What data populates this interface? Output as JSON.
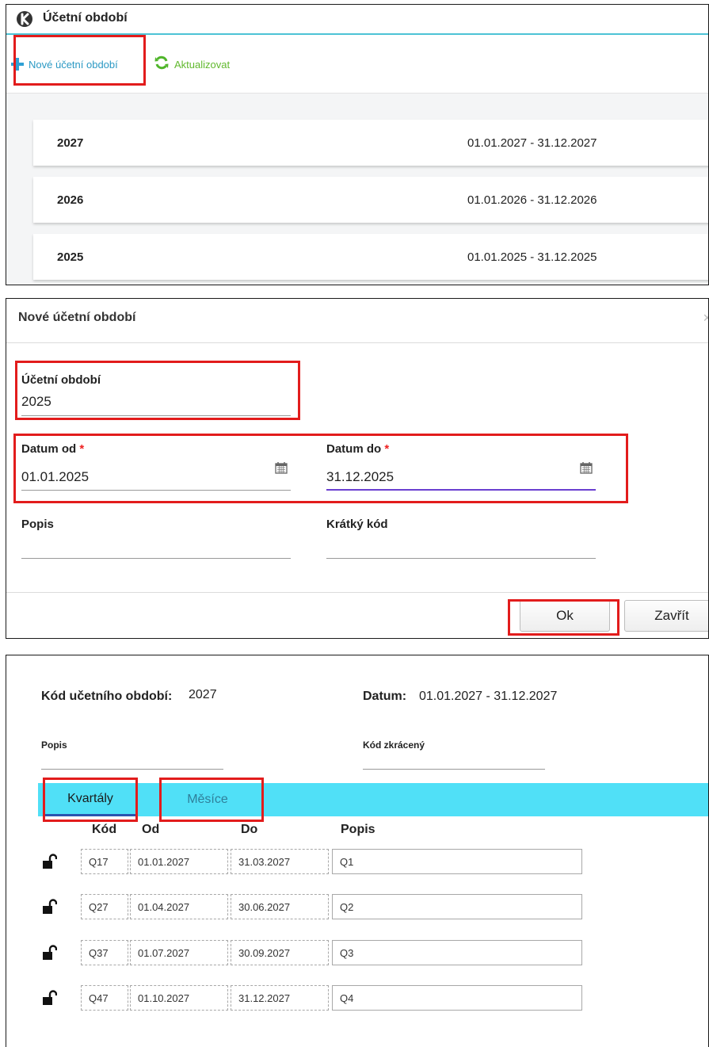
{
  "panel1": {
    "title": "Účetní období",
    "toolbar": {
      "new_label": "Nové účetní období",
      "refresh_label": "Aktualizovat"
    },
    "periods": [
      {
        "year": "2027",
        "range": "01.01.2027 - 31.12.2027"
      },
      {
        "year": "2026",
        "range": "01.01.2026 - 31.12.2026"
      },
      {
        "year": "2025",
        "range": "01.01.2025 - 31.12.2025"
      }
    ]
  },
  "panel2": {
    "title": "Nové účetní období",
    "close_glyph": "×",
    "period_label": "Účetní období",
    "period_value": "2025",
    "date_from_label": "Datum od",
    "date_from_value": "01.01.2025",
    "date_to_label": "Datum do",
    "date_to_value": "31.12.2025",
    "required_mark": "*",
    "description_label": "Popis",
    "short_code_label": "Krátký kód",
    "ok_label": "Ok",
    "close_label": "Zavřít"
  },
  "panel3": {
    "code_label": "Kód učetního období:",
    "code_value": "2027",
    "date_label": "Datum:",
    "date_value": "01.01.2027 - 31.12.2027",
    "description_label": "Popis",
    "short_code_label": "Kód zkrácený",
    "tabs": {
      "quarters": "Kvartály",
      "months": "Měsíce"
    },
    "columns": {
      "code": "Kód",
      "from": "Od",
      "to": "Do",
      "description": "Popis"
    },
    "rows": [
      {
        "code": "Q17",
        "from": "01.01.2027",
        "to": "31.03.2027",
        "description": "Q1"
      },
      {
        "code": "Q27",
        "from": "01.04.2027",
        "to": "30.06.2027",
        "description": "Q2"
      },
      {
        "code": "Q37",
        "from": "01.07.2027",
        "to": "30.09.2027",
        "description": "Q3"
      },
      {
        "code": "Q47",
        "from": "01.10.2027",
        "to": "31.12.2027",
        "description": "Q4"
      }
    ]
  },
  "colors": {
    "accent_cyan": "#50e0f7",
    "link_blue": "#2b99c4",
    "refresh_green": "#61b92e",
    "highlight_red": "#e21c1c",
    "focus_purple": "#6a3fd0"
  },
  "icons": [
    "logo-icon",
    "plus-icon",
    "refresh-icon",
    "calendar-icon",
    "unlock-icon",
    "close-icon"
  ]
}
